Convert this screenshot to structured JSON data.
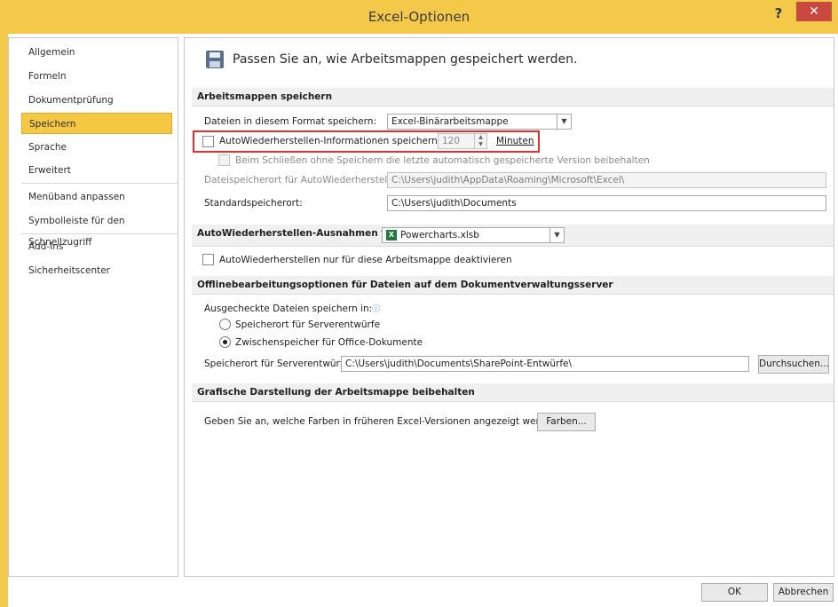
{
  "window": {
    "title": "Excel-Optionen",
    "help": "?",
    "close": "✕"
  },
  "nav": {
    "items": [
      "Allgemein",
      "Formeln",
      "Dokumentprüfung",
      "Speichern",
      "Sprache",
      "Erweitert",
      "Menüband anpassen",
      "Symbolleiste für den Schnellzugriff",
      "Add-Ins",
      "Sicherheitscenter"
    ],
    "active": "Speichern"
  },
  "header": {
    "text": "Passen Sie an, wie Arbeitsmappen gespeichert werden."
  },
  "sections": {
    "save": "Arbeitsmappen speichern",
    "exceptions": "AutoWiederherstellen-Ausnahmen für:",
    "offline": "Offlinebearbeitungsoptionen für Dateien auf dem Dokumentverwaltungsserver",
    "visual": "Grafische Darstellung der Arbeitsmappe beibehalten"
  },
  "save": {
    "format_label": "Dateien in diesem Format speichern:",
    "format_value": "Excel-Binärarbeitsmappe",
    "autorecover_label": "AutoWiederherstellen-Informationen speichern alle",
    "autorecover_minutes": "120",
    "minutes_label": "Minuten",
    "keep_last_label": "Beim Schließen ohne Speichern die letzte automatisch gespeicherte Version beibehalten",
    "autorecover_location_label": "Dateispeicherort für AutoWiederherstellen:",
    "autorecover_location_value": "C:\\Users\\judith\\AppData\\Roaming\\Microsoft\\Excel\\",
    "default_location_label": "Standardspeicherort:",
    "default_location_value": "C:\\Users\\judith\\Documents"
  },
  "exceptions": {
    "workbook": "Powercharts.xlsb",
    "disable_label": "AutoWiederherstellen nur für diese Arbeitsmappe deaktivieren"
  },
  "offline": {
    "checked_out_label": "Ausgecheckte Dateien speichern in:",
    "option_server": "Speicherort für Serverentwürfe",
    "option_cache": "Zwischenspeicher für Office-Dokumente",
    "server_drafts_label": "Speicherort für Serverentwürfe:",
    "server_drafts_value": "C:\\Users\\judith\\Documents\\SharePoint-Entwürfe\\",
    "browse": "Durchsuchen..."
  },
  "visual": {
    "colors_label": "Geben Sie an, welche Farben in früheren Excel-Versionen angezeigt werden:",
    "colors_button": "Farben..."
  },
  "footer": {
    "ok": "OK",
    "cancel": "Abbrechen"
  },
  "icons": {
    "info": "ⓘ",
    "excel": "X",
    "dropdown": "▼"
  }
}
